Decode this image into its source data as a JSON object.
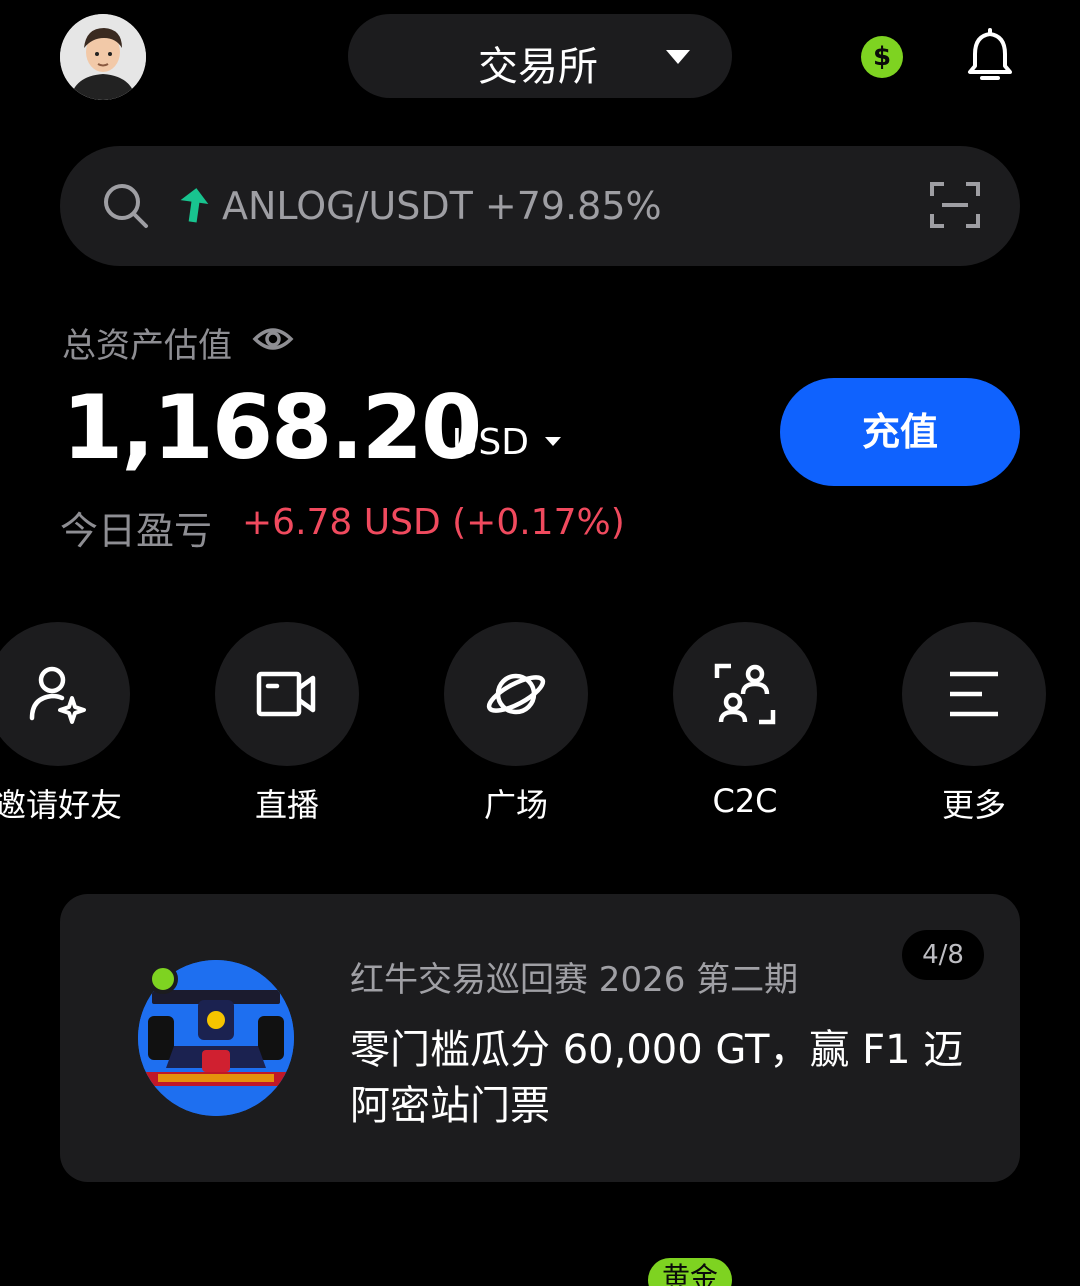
{
  "header": {
    "avatar_alt": "",
    "switcher_label": "交易所",
    "dollar_symbol": "$"
  },
  "search": {
    "ticker_text": "ANLOG/USDT +79.85%"
  },
  "assets": {
    "label": "总资产估值",
    "value": "1,168.20",
    "currency": "USD",
    "deposit_label": "充值",
    "pnl_label": "今日盈亏",
    "pnl_value": "+6.78 USD (+0.17%)"
  },
  "quick_actions": [
    {
      "label": "邀请好友",
      "icon": "invite-friend-icon"
    },
    {
      "label": "直播",
      "icon": "live-video-icon"
    },
    {
      "label": "广场",
      "icon": "planet-icon"
    },
    {
      "label": "C2C",
      "icon": "c2c-icon"
    },
    {
      "label": "更多",
      "icon": "menu-icon"
    }
  ],
  "banner": {
    "subtitle": "红牛交易巡回赛 2026 第二期",
    "title": "零门槛瓜分 60,000 GT，赢 F1 迈阿密站门票",
    "page_indicator": "4/8"
  },
  "bottom": {
    "gold_tag": "黄金"
  },
  "colors": {
    "accent_blue": "#0f62fe",
    "positive_green": "#7ed321",
    "pnl_red": "#f04a5e",
    "trend_green": "#18c48f",
    "card_bg": "#1c1c1e"
  }
}
